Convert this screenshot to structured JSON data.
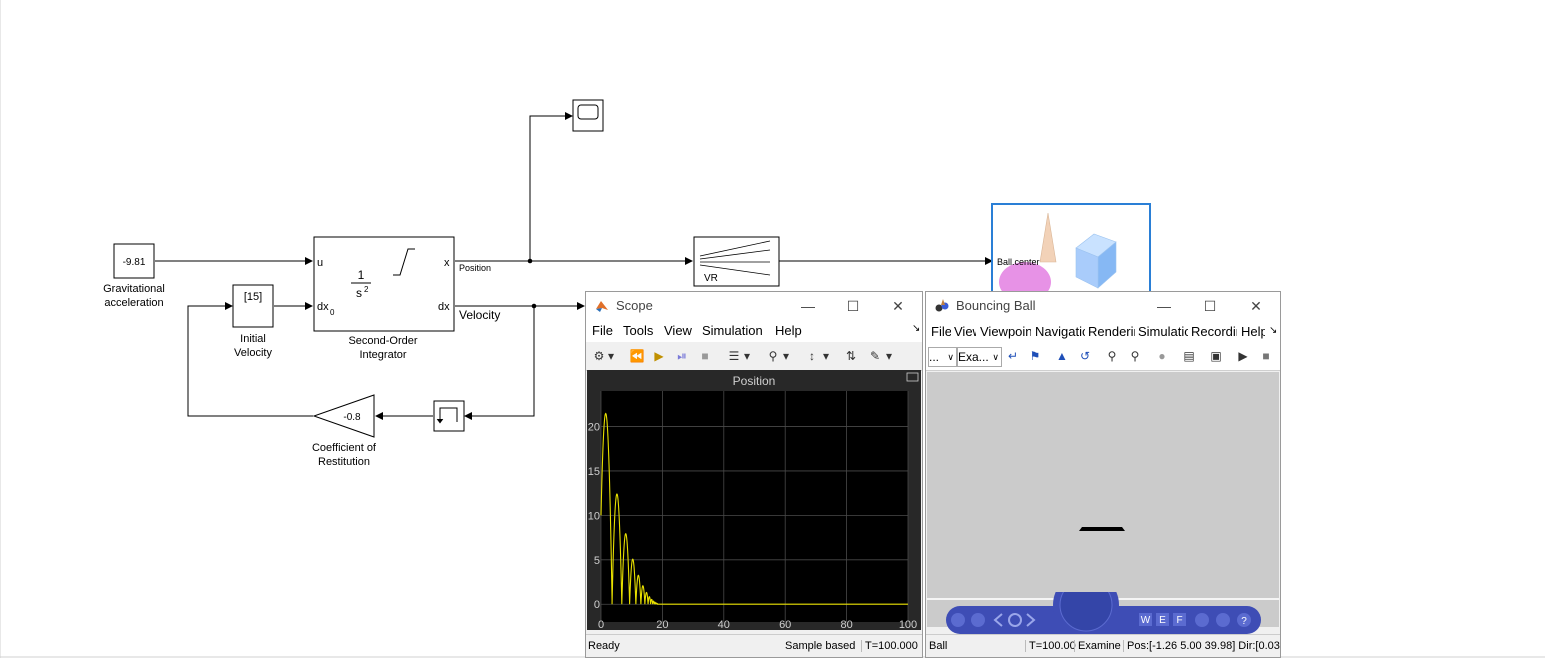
{
  "diagram": {
    "gravity_block": {
      "value": "-9.81",
      "label_line1": "Gravitational",
      "label_line2": "acceleration"
    },
    "initial_velocity_block": {
      "value": "[15]",
      "label_line1": "Initial",
      "label_line2": "Velocity"
    },
    "integrator_block": {
      "port_u": "u",
      "port_dx0": "dx",
      "port_dx0_sub": "0",
      "port_x": "x",
      "port_dx": "dx",
      "tf_num": "1",
      "tf_den": "s",
      "tf_den_exp": "2",
      "label_line1": "Second-Order",
      "label_line2": "Integrator"
    },
    "signal_position": "Position",
    "signal_velocity": "Velocity",
    "gain_block": {
      "value": "-0.8",
      "label_line1": "Coefficient of",
      "label_line2": "Restitution"
    },
    "vr_sink_block": {
      "label": "VR"
    },
    "vr_preview_block": {
      "port_label": "Ball.center"
    }
  },
  "scope_window": {
    "title": "Scope",
    "menu": [
      "File",
      "Tools",
      "View",
      "Simulation",
      "Help"
    ],
    "plot_title": "Position",
    "status": {
      "left": "Ready",
      "mode": "Sample based",
      "time": "T=100.000"
    },
    "colors": {
      "plot_bg": "#000000",
      "trace": "#e8e000",
      "frame_bg": "#282828"
    }
  },
  "vr_window": {
    "title": "Bouncing Ball",
    "menu": [
      "File",
      "View",
      "Viewpoints",
      "Navigation",
      "Rendering",
      "Simulation",
      "Recording",
      "Help"
    ],
    "viewpoint_select": "...",
    "nav_mode_select": "Exa...",
    "nav_buttons": [
      "W",
      "E",
      "F"
    ],
    "status": {
      "object": "Ball",
      "time": "T=100.00",
      "mode": "Examine",
      "pos": "Pos:[-1.26 5.00 39.98] Dir:[0.03"
    },
    "colors": {
      "nav_blue": "#3e4db5",
      "view_bg": "#cbcbcb"
    }
  },
  "chart_data": {
    "type": "line",
    "title": "Position",
    "xlim": [
      0,
      100
    ],
    "ylim": [
      -2,
      24
    ],
    "xticks": [
      0,
      20,
      40,
      60,
      80,
      100
    ],
    "yticks": [
      0,
      5,
      10,
      15,
      20
    ],
    "grid": true,
    "series": [
      {
        "bounces": [
          {
            "start": 0.0,
            "v0": 15.0,
            "y0": 10.0
          },
          {
            "start": 3.6,
            "v0": 15.6
          },
          {
            "start": 6.78,
            "v0": 12.48
          },
          {
            "start": 9.32,
            "v0": 9.98
          },
          {
            "start": 11.36,
            "v0": 7.99
          },
          {
            "start": 12.99,
            "v0": 6.39
          },
          {
            "start": 14.29,
            "v0": 5.11
          },
          {
            "start": 15.33,
            "v0": 4.09
          },
          {
            "start": 16.17,
            "v0": 3.27
          },
          {
            "start": 16.84,
            "v0": 2.62
          },
          {
            "start": 17.37,
            "v0": 2.09
          },
          {
            "start": 17.8,
            "v0": 1.67
          },
          {
            "start": 18.14,
            "v0": 1.34
          }
        ],
        "rest_after": 18.41,
        "rest_value": 0
      }
    ]
  }
}
